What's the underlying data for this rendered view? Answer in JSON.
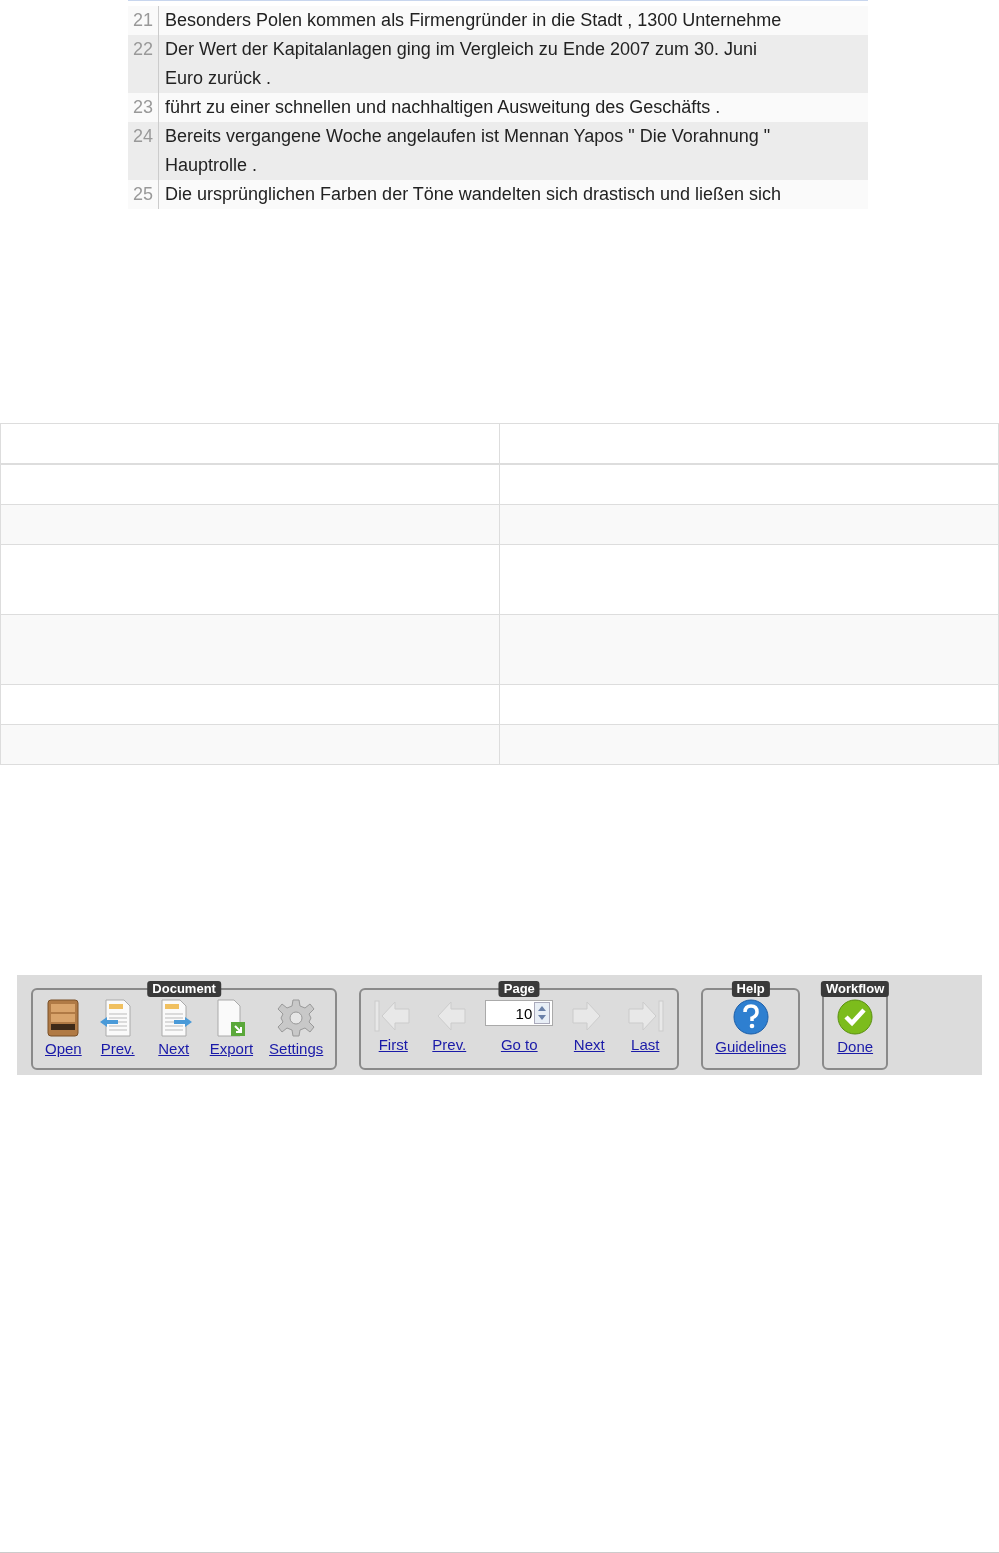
{
  "sentences": [
    {
      "number": "21",
      "lines": [
        "Besonders Polen kommen als Firmengründer in die Stadt , 1300 Unternehme"
      ]
    },
    {
      "number": "22",
      "lines": [
        "Der Wert der Kapitalanlagen ging im Vergleich zu Ende 2007 zum 30. Juni",
        "Euro zurück ."
      ]
    },
    {
      "number": "23",
      "lines": [
        "führt zu einer schnellen und nachhaltigen Ausweitung des Geschäfts ."
      ]
    },
    {
      "number": "24",
      "lines": [
        "Bereits vergangene Woche angelaufen ist Mennan Yapos \" Die Vorahnung \"",
        "Hauptrolle ."
      ]
    },
    {
      "number": "25",
      "lines": [
        "Die ursprünglichen Farben der Töne wandelten sich drastisch und ließen sich"
      ]
    }
  ],
  "toolbar": {
    "groups": [
      {
        "title": "Document",
        "items": [
          {
            "kind": "open",
            "label": "Open",
            "disabled": false
          },
          {
            "kind": "prev-doc",
            "label": "Prev.",
            "disabled": false
          },
          {
            "kind": "next-doc",
            "label": "Next",
            "disabled": false
          },
          {
            "kind": "export",
            "label": "Export",
            "disabled": false
          },
          {
            "kind": "settings",
            "label": "Settings",
            "disabled": false
          }
        ]
      },
      {
        "title": "Page",
        "items": [
          {
            "kind": "first",
            "label": "First",
            "disabled": true
          },
          {
            "kind": "prev",
            "label": "Prev.",
            "disabled": true
          },
          {
            "kind": "goto",
            "label": "Go to",
            "value": "10",
            "disabled": false
          },
          {
            "kind": "next",
            "label": "Next",
            "disabled": true
          },
          {
            "kind": "last",
            "label": "Last",
            "disabled": true
          }
        ]
      },
      {
        "title": "Help",
        "items": [
          {
            "kind": "help",
            "label": "Guidelines",
            "disabled": false
          }
        ]
      },
      {
        "title": "Workflow",
        "items": [
          {
            "kind": "done",
            "label": "Done",
            "disabled": false
          }
        ]
      }
    ]
  }
}
